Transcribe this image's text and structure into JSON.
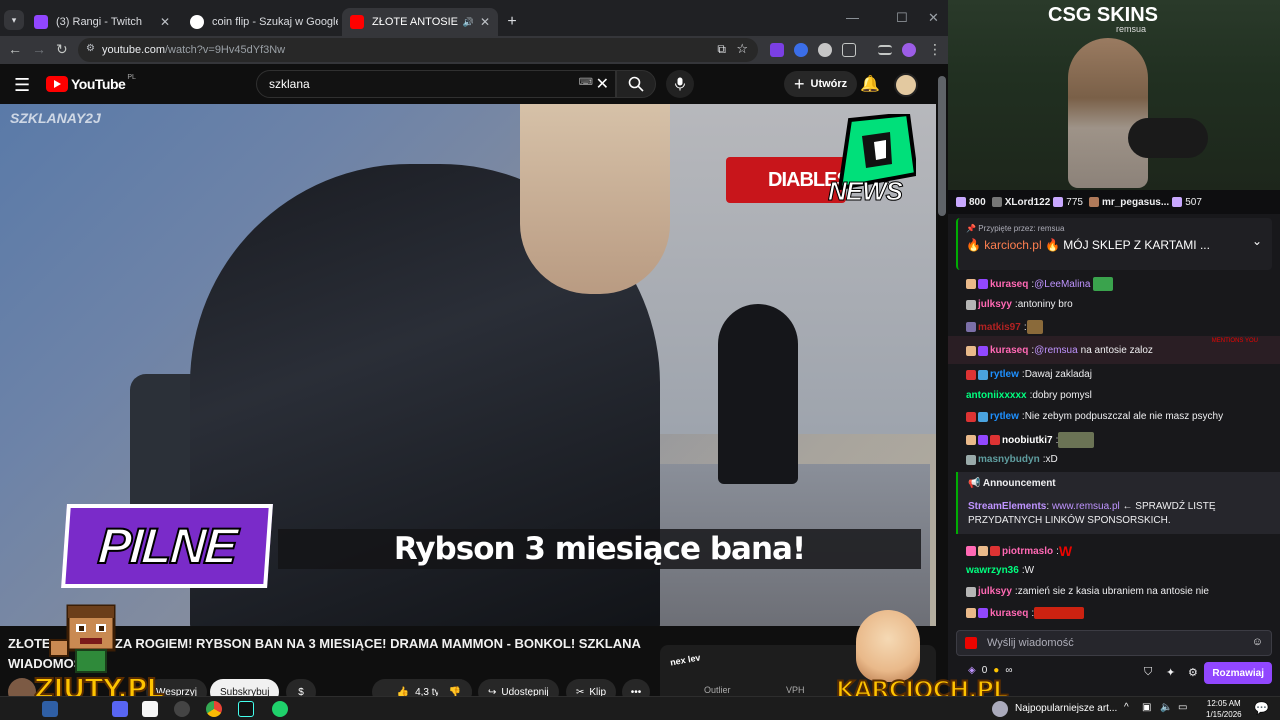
{
  "browser": {
    "tabs": [
      {
        "title": "(3) Rangi - Twitch",
        "color": "#9146ff"
      },
      {
        "title": "coin flip - Szukaj w Google",
        "color": "#4285f4"
      },
      {
        "title": "ZŁOTE ANTOSIE ZA ROGIEM",
        "color": "#ff0000"
      }
    ],
    "new_tab": "+",
    "url_host": "youtube.com",
    "url_path": "/watch?v=9Hv45dYf3Nw"
  },
  "youtube": {
    "logo": "YouTube",
    "region": "PL",
    "search_value": "szklana",
    "create_label": "Utwórz",
    "video": {
      "watermark": "SZKLANAY2J",
      "banner_text": "DIABLES",
      "news_text": "NEWS",
      "pilne": "PILNE",
      "caption": "Rybson 3 miesiące bana!"
    },
    "title_line1": "ZŁOTE ANTOSIE ZA ROGIEM! RYBSON BAN NA 3 MIESIĄCE! DRAMA MAMMON - BONKOL! SZKLANA",
    "title_line2": "WIADOMOŚCI",
    "actions": {
      "join": "Wesprzyj",
      "subscribe": "Subskrybuj",
      "dollar": "$",
      "likes": "4,3 tys.",
      "share": "Udostępnij",
      "clip": "Klip",
      "more": "•••"
    },
    "sidebox": {
      "logo": "nex lev",
      "col1": "Outlier",
      "col2": "VPH"
    }
  },
  "overlays": {
    "ziuty": "ZIUTY.PL",
    "karcioch": "KARCIOCH.PL"
  },
  "twitch": {
    "sponsor": "CSG SKINS",
    "cam_user": "remsua",
    "gifters": [
      {
        "name": "",
        "count": "800"
      },
      {
        "name": "XLord122",
        "count": "775"
      },
      {
        "name": "mr_pegasus...",
        "count": "507"
      }
    ],
    "pinned_label": "Przypięte przez: remsua",
    "pinned_user": "karcioch.pl",
    "pinned_msg": "MÓJ SKLEP Z KARTAMI ...",
    "chat": [
      {
        "user": "kuraseq",
        "color": "#ff69b4",
        "mention": "@LeeMalina",
        "text": ""
      },
      {
        "user": "julksyy",
        "color": "#ff69b4",
        "mention": "",
        "text": "antoniny bro"
      },
      {
        "user": "matkis97",
        "color": "#b22222",
        "mention": "",
        "text": ""
      },
      {
        "user": "kuraseq",
        "color": "#ff69b4",
        "mention": "@remsua",
        "text": "na antosie zaloz"
      },
      {
        "user": "rytlew",
        "color": "#1e90ff",
        "mention": "",
        "text": "Dawaj zakladaj"
      },
      {
        "user": "antoniixxxxx",
        "color": "#00ff7f",
        "mention": "",
        "text": "dobry pomysl"
      },
      {
        "user": "rytlew",
        "color": "#1e90ff",
        "mention": "",
        "text": "Nie zebym podpuszczal ale nie masz psychy"
      },
      {
        "user": "noobiutki7",
        "color": "#ffffff",
        "mention": "",
        "text": ""
      },
      {
        "user": "masnybudyn",
        "color": "#5f9ea0",
        "mention": "",
        "text": "xD"
      }
    ],
    "announcement": {
      "header": "Announcement",
      "user": "StreamElements",
      "link": "www.remsua.pl",
      "text": "← SPRAWDŹ LISTĘ PRZYDATNYCH LINKÓW SPONSORSKICH."
    },
    "chat2": [
      {
        "user": "piotrmaslo",
        "color": "#ff69b4",
        "text": "W"
      },
      {
        "user": "wawrzyn36",
        "color": "#00ff7f",
        "text": "W"
      },
      {
        "user": "julksyy",
        "color": "#ff69b4",
        "text": "zamień sie z kasia ubraniem na antosie nie"
      },
      {
        "user": "kuraseq",
        "color": "#ff69b4",
        "text": ""
      }
    ],
    "mentions_label": "MENTIONS YOU",
    "input_placeholder": "Wyślij wiadomość",
    "points": "0",
    "points_extra": "∞",
    "send_label": "Rozmawiaj"
  },
  "taskbar": {
    "notification": "Najpopularniejsze art...",
    "time": "12:05 AM",
    "date": "1/15/2026"
  }
}
